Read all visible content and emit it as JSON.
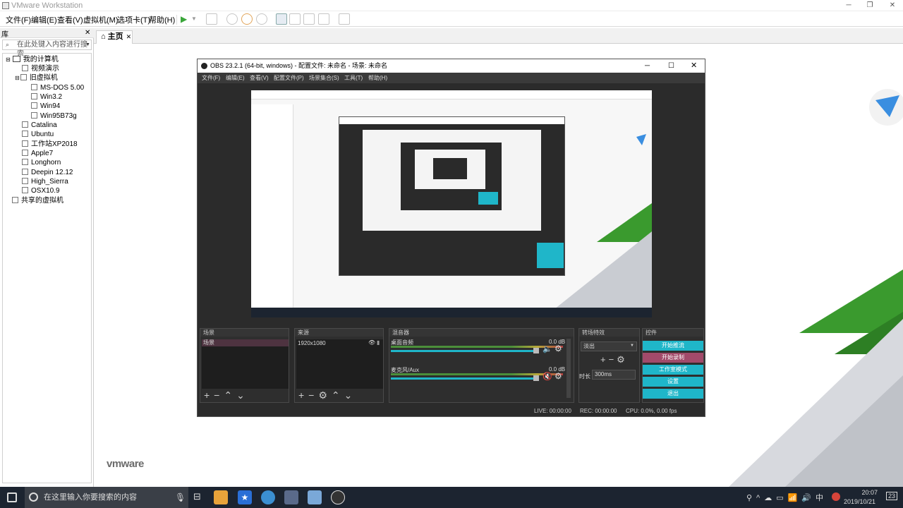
{
  "window": {
    "title": "VMware Workstation"
  },
  "menu": [
    "文件(F)",
    "编辑(E)",
    "查看(V)",
    "虚拟机(M)",
    "选项卡(T)",
    "帮助(H)"
  ],
  "library": {
    "header": "库",
    "search_placeholder": "在此处键入内容进行搜索",
    "tree": [
      {
        "label": "我的计算机",
        "level": 0
      },
      {
        "label": "视频演示",
        "level": 1
      },
      {
        "label": "旧虚拟机",
        "level": 1
      },
      {
        "label": "MS-DOS 5.00",
        "level": 2
      },
      {
        "label": "Win3.2",
        "level": 2
      },
      {
        "label": "Win94",
        "level": 2
      },
      {
        "label": "Win95B73g",
        "level": 2
      },
      {
        "label": "Catalina",
        "level": 1
      },
      {
        "label": "Ubuntu",
        "level": 1
      },
      {
        "label": "工作站XP2018",
        "level": 1
      },
      {
        "label": "Apple7",
        "level": 1
      },
      {
        "label": "Longhorn",
        "level": 1
      },
      {
        "label": "Deepin 12.12",
        "level": 1
      },
      {
        "label": "High_Sierra",
        "level": 1
      },
      {
        "label": "OSX10.9",
        "level": 1
      },
      {
        "label": "共享的虚拟机",
        "level": 0
      }
    ]
  },
  "tabs": {
    "home": "主页"
  },
  "branding": {
    "vmware": "vmware"
  },
  "obs": {
    "title": "OBS 23.2.1 (64-bit, windows) - 配置文件: 未命名 - 场景: 未命名",
    "menu": [
      "文件(F)",
      "编辑(E)",
      "查看(V)",
      "配置文件(P)",
      "场景集合(S)",
      "工具(T)",
      "帮助(H)"
    ],
    "docks": {
      "scenes": {
        "title": "场景",
        "item": "场景"
      },
      "sources": {
        "title": "来源",
        "item": "1920x1080"
      },
      "mixer": {
        "title": "混音器",
        "channels": [
          {
            "name": "桌面音频",
            "db": "0.0 dB",
            "muted": false
          },
          {
            "name": "麦克风/Aux",
            "db": "0.0 dB",
            "muted": true
          }
        ],
        "scale": [
          "-60",
          "-55",
          "-50",
          "-45",
          "-40",
          "-35",
          "-30",
          "-25",
          "-20",
          "-15",
          "-10",
          "-5",
          "0"
        ]
      },
      "transitions": {
        "title": "转场特效",
        "selected": "淡出",
        "duration_label": "时长",
        "duration": "300ms"
      },
      "controls": {
        "title": "控件",
        "buttons": [
          "开始推流",
          "开始录制",
          "工作室模式",
          "设置",
          "退出"
        ]
      }
    },
    "status": {
      "live": "LIVE: 00:00:00",
      "rec": "REC: 00:00:00",
      "cpu": "CPU: 0.0%, 0.00 fps"
    }
  },
  "taskbar": {
    "search": "在这里输入你要搜索的内容",
    "clock_time": "20:07",
    "clock_date": "2019/10/21",
    "notify_count": "23"
  },
  "colors": {
    "accent": "#1fb6c9",
    "record": "#a24a6a",
    "vm_green": "#3a9a2e"
  }
}
